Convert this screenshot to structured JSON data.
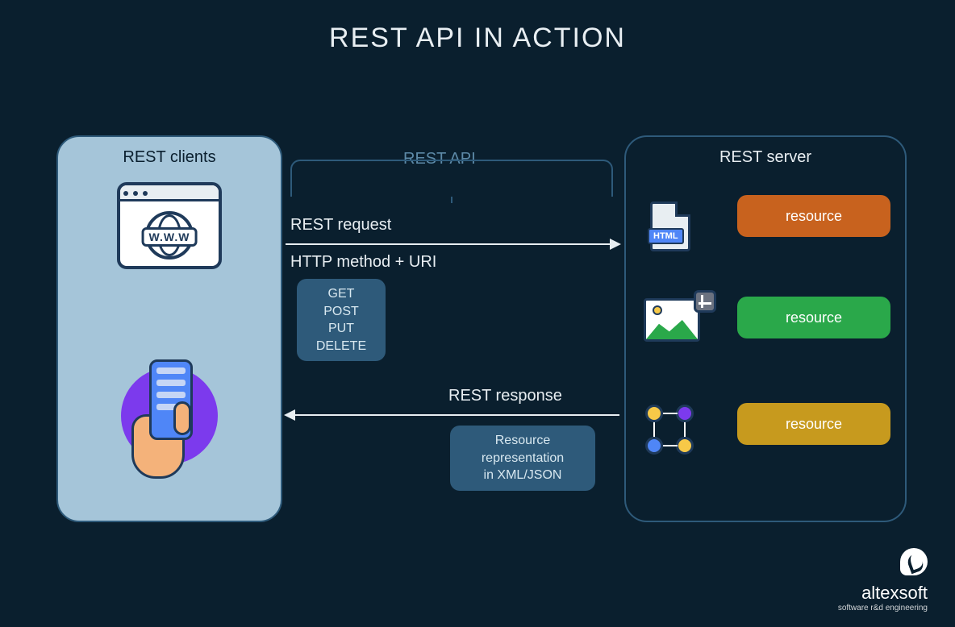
{
  "title": "REST API IN ACTION",
  "clients_panel_title": "REST clients",
  "server_panel_title": "REST server",
  "api_label": "REST API",
  "request_label": "REST request",
  "methods_label": "HTTP method + URI",
  "http_methods": [
    "GET",
    "POST",
    "PUT",
    "DELETE"
  ],
  "response_label": "REST response",
  "representation_lines": [
    "Resource",
    "representation",
    "in XML/JSON"
  ],
  "browser_www": "W.W.W",
  "html_file_tag": "HTML",
  "resources": [
    {
      "label": "resource",
      "color": "#c8621e",
      "type": "html"
    },
    {
      "label": "resource",
      "color": "#2aa84a",
      "type": "image"
    },
    {
      "label": "resource",
      "color": "#c79a1e",
      "type": "users"
    }
  ],
  "logo": {
    "name": "altexsoft",
    "tagline": "software r&d engineering"
  }
}
